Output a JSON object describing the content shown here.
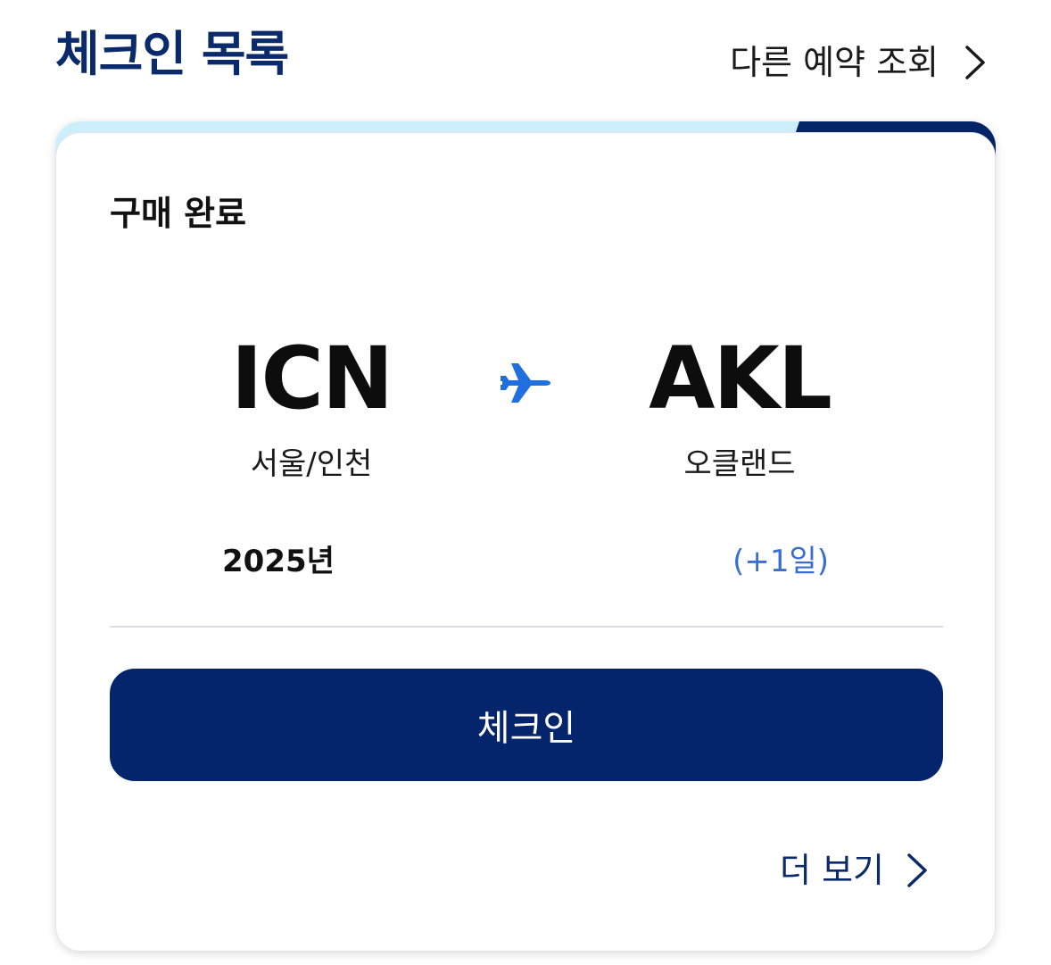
{
  "header": {
    "title": "체크인 목록",
    "other_booking_label": "다른 예약 조회"
  },
  "card": {
    "status": "구매 완료",
    "origin": {
      "code": "ICN",
      "city": "서울/인천"
    },
    "destination": {
      "code": "AKL",
      "city": "오클랜드"
    },
    "departure_date": "2025년",
    "arrival_day_offset": "(+1일)",
    "checkin_button_label": "체크인",
    "more_label": "더 보기"
  },
  "colors": {
    "brand_navy": "#04256b",
    "accent_blue": "#3a6fcf",
    "plane_blue": "#1f6fe0",
    "top_band_light": "#cdeefb"
  },
  "icons": {
    "header_chevron": "chevron-right-icon",
    "route_plane": "airplane-icon",
    "more_chevron": "chevron-right-icon"
  }
}
